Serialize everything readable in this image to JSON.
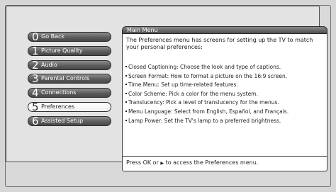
{
  "menu": {
    "title": "Main Menu",
    "items": [
      {
        "number": "0",
        "label": "Go Back",
        "active": false
      },
      {
        "number": "1",
        "label": "Picture Quality",
        "active": false
      },
      {
        "number": "2",
        "label": "Audio",
        "active": false
      },
      {
        "number": "3",
        "label": "Parental Controls",
        "active": false
      },
      {
        "number": "4",
        "label": "Connections",
        "active": false
      },
      {
        "number": "5",
        "label": "Preferences",
        "active": true
      },
      {
        "number": "6",
        "label": "Assisted Setup",
        "active": false
      }
    ]
  },
  "content": {
    "intro": "The Preferences menu has screens for setting up the TV to match your personal preferences:",
    "items": [
      "Closed Captioning: Choose the look and type of captions.",
      "Screen Format: How to format a picture on the 16:9 screen.",
      "Time Menu: Set up time-related features.",
      "Color Scheme: Pick a color for the menu system.",
      "Translucency: Pick a level of translucency for the menus.",
      "Menu Language: Select from English, Español, and Français.",
      "Lamp Power: Set the TV's lamp to a preferred brightness."
    ],
    "status_before": "Press OK or",
    "status_arrow": "▶",
    "status_after": "to access the Preferences menu."
  }
}
